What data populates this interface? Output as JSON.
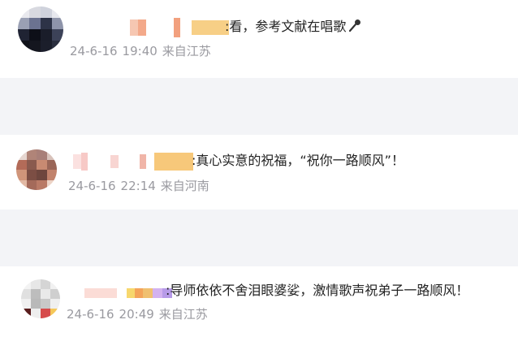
{
  "comments": [
    {
      "text": ":看，参考文献在唱歌",
      "date": "24-6-16",
      "time": "19:40",
      "location": "来自江苏",
      "icon": "microphone-icon"
    },
    {
      "text": ":真心实意的祝福，“祝你一路顺风”！",
      "date": "24-6-16",
      "time": "22:14",
      "location": "来自河南"
    },
    {
      "text": ":导师依依不舍泪眼婆娑，激情歌声祝弟子一路顺风！",
      "date": "24-6-16",
      "time": "20:49",
      "location": "来自江苏"
    }
  ],
  "colors": {
    "separator": "#f3f4f7",
    "meta_text": "#9a9aa0",
    "body_text": "#222222"
  }
}
